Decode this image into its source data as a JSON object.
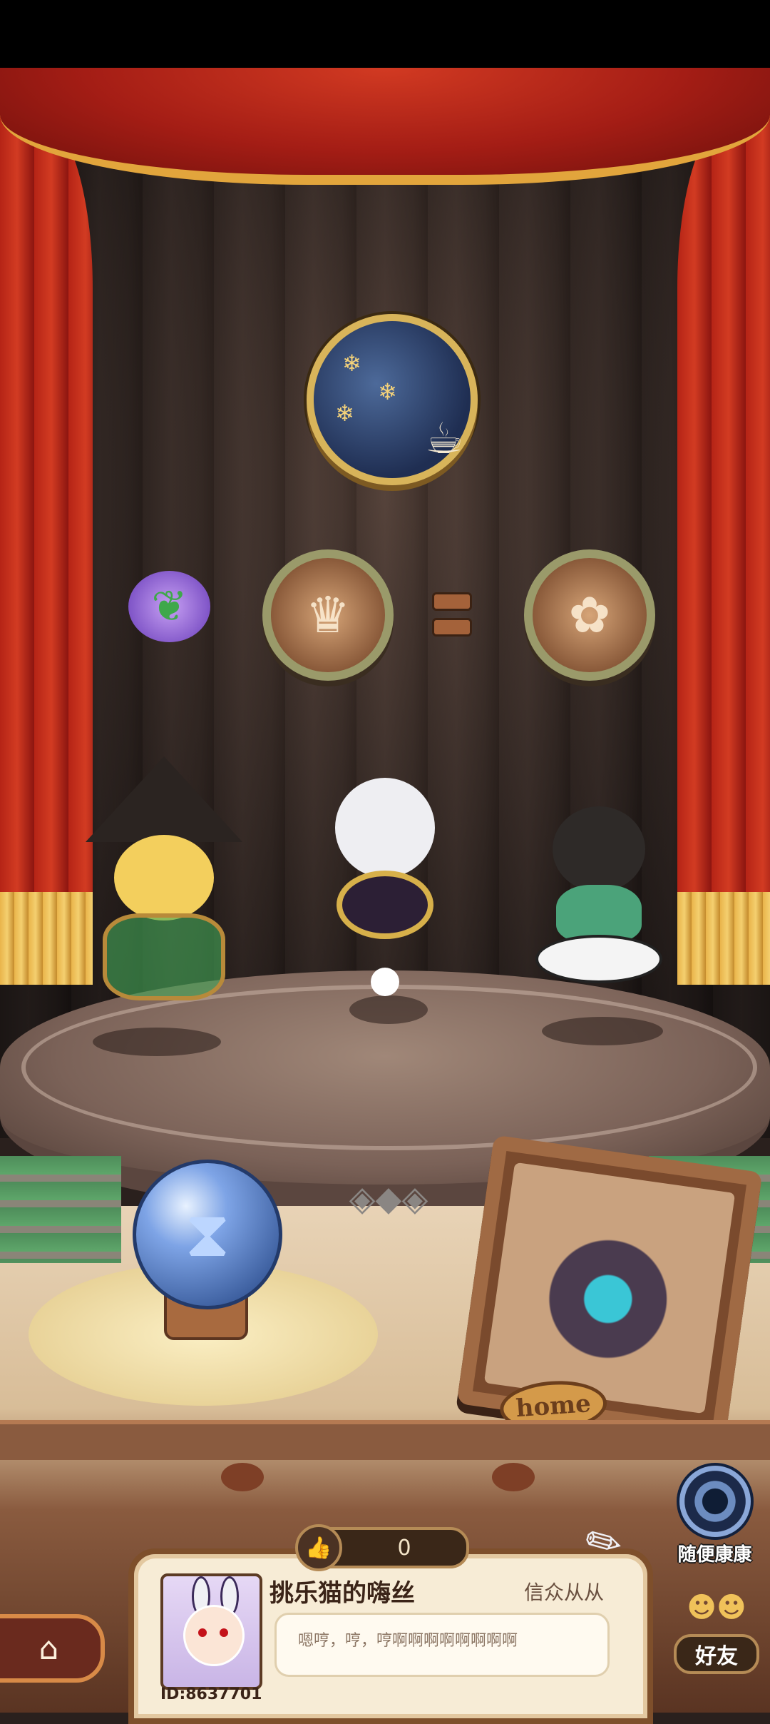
{
  "colors": {
    "curtain_red": "#b52416",
    "gold": "#e2a53c",
    "stage_wood": "#7b6258",
    "card_bg": "#f7ecd6"
  },
  "recipe": {
    "ingredient_icon": "leaf-icon",
    "slot_left_icon": "fairy-silhouette-icon",
    "slot_right_icon": "thumbs-up-flower-icon",
    "badge_icon": "tea-cup-icon"
  },
  "stage": {
    "characters": [
      "witch-in-cage",
      "bunny-with-pocket-watch",
      "girl-on-yinyang"
    ],
    "orb_icon": "hourglass-icon",
    "frame_plate": "home"
  },
  "random_visit": {
    "label": "随便康康"
  },
  "likes": {
    "count": "0"
  },
  "profile": {
    "username": "挑乐猫的嗨丝",
    "title": "信众从从",
    "bio": "嗯哼，哼，哼啊啊啊啊啊啊啊啊",
    "id": "ID:8637701"
  },
  "nav": {
    "home_icon": "home-icon"
  },
  "friends": {
    "label": "好友"
  }
}
